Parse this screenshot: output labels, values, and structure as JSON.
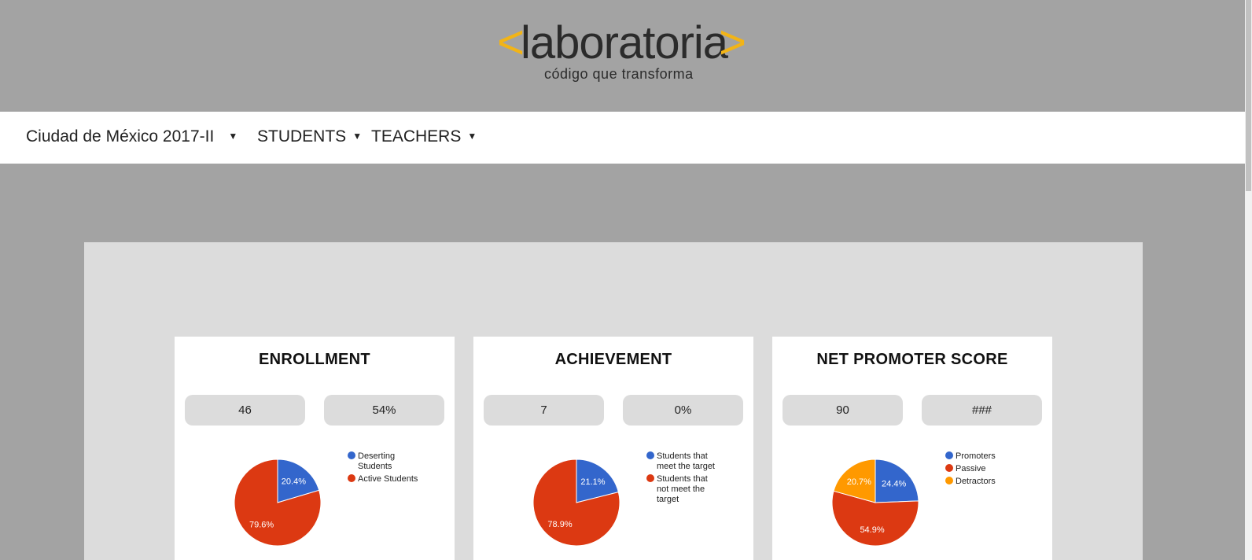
{
  "header": {
    "logo_left": "<",
    "logo_word": "laboratoria",
    "logo_right": ">",
    "tagline": "código que transforma"
  },
  "nav": {
    "cohort": "Ciudad de México 2017-II",
    "students": "STUDENTS",
    "teachers": "TEACHERS",
    "caret": "▼"
  },
  "colors": {
    "blue": "#3366cc",
    "red": "#dc3912",
    "orange": "#ff9900",
    "accent": "#f2b417"
  },
  "cards": [
    {
      "title": "ENROLLMENT",
      "value_a": "46",
      "value_b": "54%"
    },
    {
      "title": "ACHIEVEMENT",
      "value_a": "7",
      "value_b": "0%"
    },
    {
      "title": "NET PROMOTER SCORE",
      "value_a": "90",
      "value_b": "###"
    }
  ],
  "chart_data": [
    {
      "type": "pie",
      "slices": [
        {
          "label": "Deserting Students",
          "value": 20.4,
          "color": "#3366cc"
        },
        {
          "label": "Active Students",
          "value": 79.6,
          "color": "#dc3912"
        }
      ]
    },
    {
      "type": "pie",
      "slices": [
        {
          "label": "Students that meet the target",
          "value": 21.1,
          "color": "#3366cc"
        },
        {
          "label": "Students that not meet the target",
          "value": 78.9,
          "color": "#dc3912"
        }
      ]
    },
    {
      "type": "pie",
      "slices": [
        {
          "label": "Promoters",
          "value": 24.4,
          "color": "#3366cc"
        },
        {
          "label": "Passive",
          "value": 54.9,
          "color": "#dc3912"
        },
        {
          "label": "Detractors",
          "value": 20.7,
          "color": "#ff9900"
        }
      ]
    }
  ]
}
